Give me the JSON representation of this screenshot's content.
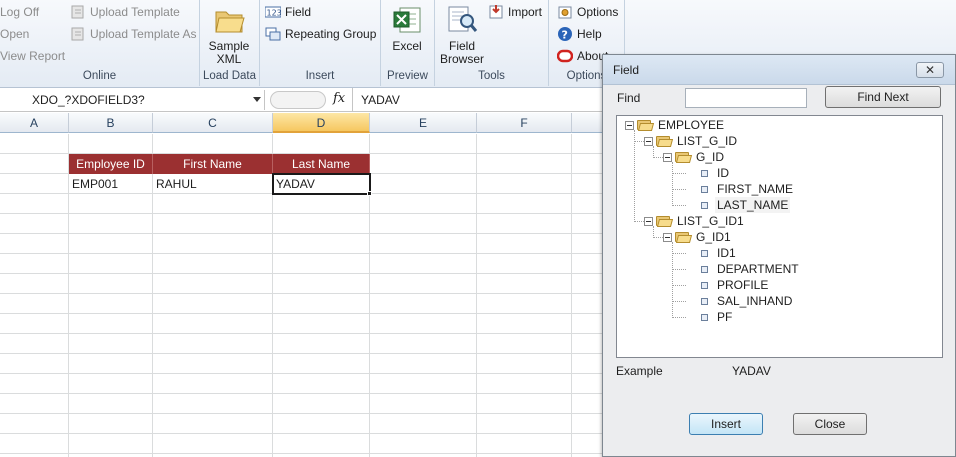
{
  "ribbon": {
    "online": {
      "label": "Online",
      "log_off": "Log Off",
      "open": "Open",
      "view_report": "View Report",
      "upload_template": "Upload Template",
      "upload_template_as": "Upload Template As"
    },
    "load_data": {
      "label": "Load Data",
      "sample_xml": "Sample\nXML"
    },
    "insert": {
      "label": "Insert",
      "field": "Field",
      "repeating_group": "Repeating Group"
    },
    "preview": {
      "label": "Preview",
      "excel": "Excel"
    },
    "tools": {
      "label": "Tools",
      "field_browser": "Field\nBrowser",
      "import": "Import"
    },
    "options": {
      "label": "Options",
      "options": "Options",
      "help": "Help",
      "about": "About"
    }
  },
  "formula_bar": {
    "name_box": "XDO_?XDOFIELD3?",
    "fx": "fx",
    "value": "YADAV"
  },
  "sheet": {
    "columns": [
      "A",
      "B",
      "C",
      "D",
      "E",
      "F"
    ],
    "selected_column": "D",
    "header_row": [
      "Employee ID",
      "First Name",
      "Last Name"
    ],
    "data_row": [
      "EMP001",
      "RAHUL",
      "YADAV"
    ]
  },
  "dialog": {
    "title": "Field",
    "close_glyph": "✕",
    "find_label": "Find",
    "find_value": "",
    "find_next": "Find Next",
    "tree": {
      "root": "EMPLOYEE",
      "list1": "LIST_G_ID",
      "group1": "G_ID",
      "group1_fields": [
        "ID",
        "FIRST_NAME",
        "LAST_NAME"
      ],
      "list2": "LIST_G_ID1",
      "group2": "G_ID1",
      "group2_fields": [
        "ID1",
        "DEPARTMENT",
        "PROFILE",
        "SAL_INHAND",
        "PF"
      ],
      "selected": "LAST_NAME"
    },
    "example_label": "Example",
    "example_value": "YADAV",
    "insert": "Insert",
    "close": "Close"
  },
  "colors": {
    "header_fill": "#9b3031",
    "header_text": "#ffffff",
    "selected_col": "#f6c760"
  }
}
